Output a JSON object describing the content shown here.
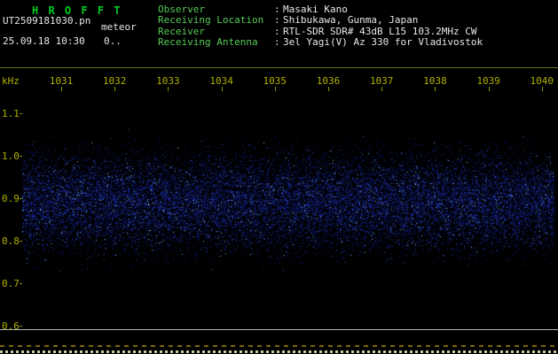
{
  "app": {
    "title": "H R O F F T",
    "accent_green": "#00cc22",
    "accent_yellow": "#b0b000"
  },
  "header": {
    "filename": "UT2509181030.pn",
    "station": "meteor",
    "datetime": "25.09.18 10:30",
    "count": "0..",
    "colon": ":",
    "info": [
      {
        "label": "Observer",
        "value": "Masaki Kano"
      },
      {
        "label": "Receiving Location",
        "value": "Shibukawa, Gunma, Japan"
      },
      {
        "label": "Receiver",
        "value": "RTL-SDR SDR# 43dB L15 103.2MHz CW"
      },
      {
        "label": "Receiving Antenna",
        "value": "3el Yagi(V) Az 330 for Vladivostok"
      }
    ]
  },
  "axes": {
    "ylabel": "kHz",
    "time_ticks": [
      "1031",
      "1032",
      "1033",
      "1034",
      "1035",
      "1036",
      "1037",
      "1038",
      "1039",
      "1040"
    ],
    "freq_ticks": [
      "1.1",
      "1.0",
      "0.9",
      "0.8",
      "0.7",
      "0.6"
    ]
  },
  "spectrogram": {
    "noise_band_top_khz": 1.0,
    "noise_band_bottom_khz": 0.78,
    "noise_color": "#2a3cc8",
    "highlight_color": "#8cdcff"
  }
}
